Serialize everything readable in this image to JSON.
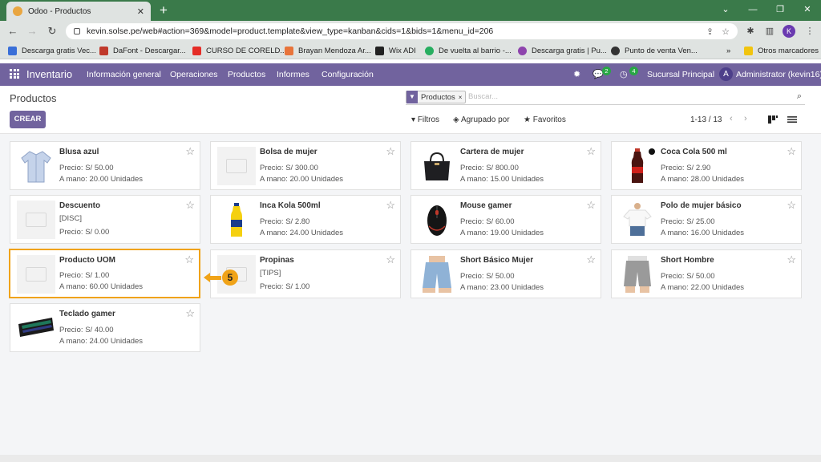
{
  "browser": {
    "tab_title": "Odoo - Productos",
    "tab_close": "✕",
    "new_tab": "+",
    "url": "kevin.solse.pe/web#action=369&model=product.template&view_type=kanban&cids=1&bids=1&menu_id=206",
    "profile_initial": "K",
    "bookmarks": [
      {
        "label": "Descarga gratis Vec...",
        "color": "#3a6fd8"
      },
      {
        "label": "DaFont - Descargar...",
        "color": "#c0392b"
      },
      {
        "label": "CURSO DE CORELD...",
        "color": "#e52d27"
      },
      {
        "label": "Brayan Mendoza Ar...",
        "color": "#e8743b"
      },
      {
        "label": "Wix ADI",
        "color": "#222222"
      },
      {
        "label": "De vuelta al barrio -...",
        "color": "#27ae60"
      },
      {
        "label": "Descarga gratis | Pu...",
        "color": "#8e44ad"
      },
      {
        "label": "Punto de venta Ven...",
        "color": "#333333"
      }
    ],
    "bookmarks_more": "»",
    "other_bookmarks": "Otros marcadores"
  },
  "navbar": {
    "app_name": "Inventario",
    "menu": [
      "Información general",
      "Operaciones",
      "Productos",
      "Informes",
      "Configuración"
    ],
    "messages_count": "2",
    "activities_count": "4",
    "company": "Sucursal Principal",
    "user_initial": "A",
    "user_name": "Administrator (kevin16)"
  },
  "control_panel": {
    "title": "Productos",
    "create_label": "CREAR",
    "facet_label": "Productos",
    "facet_remove": "×",
    "search_placeholder": "Buscar...",
    "filters_label": "Filtros",
    "group_by_label": "Agrupado por",
    "favorites_label": "Favoritos",
    "pager": "1-13 / 13"
  },
  "products": [
    {
      "name": "Blusa azul",
      "ref": "",
      "price": "Precio: S/ 50.00",
      "qty": "A mano: 20.00 Unidades",
      "image": "blouse"
    },
    {
      "name": "Bolsa de mujer",
      "ref": "",
      "price": "Precio: S/ 300.00",
      "qty": "A mano: 20.00 Unidades",
      "image": "placeholder"
    },
    {
      "name": "Cartera de mujer",
      "ref": "",
      "price": "Precio: S/ 800.00",
      "qty": "A mano: 15.00 Unidades",
      "image": "handbag"
    },
    {
      "name": "Coca Cola 500 ml",
      "ref": "",
      "price": "Precio: S/ 2.90",
      "qty": "A mano: 28.00 Unidades",
      "image": "cola"
    },
    {
      "name": "Descuento",
      "ref": "[DISC]",
      "price": "Precio: S/ 0.00",
      "qty": "",
      "image": "placeholder"
    },
    {
      "name": "Inca Kola 500ml",
      "ref": "",
      "price": "Precio: S/ 2.80",
      "qty": "A mano: 24.00 Unidades",
      "image": "inca"
    },
    {
      "name": "Mouse gamer",
      "ref": "",
      "price": "Precio: S/ 60.00",
      "qty": "A mano: 19.00 Unidades",
      "image": "mouse"
    },
    {
      "name": "Polo de mujer básico",
      "ref": "",
      "price": "Precio: S/ 25.00",
      "qty": "A mano: 16.00 Unidades",
      "image": "tshirt"
    },
    {
      "name": "Producto UOM",
      "ref": "",
      "price": "Precio: S/ 1.00",
      "qty": "A mano: 60.00 Unidades",
      "image": "placeholder"
    },
    {
      "name": "Propinas",
      "ref": "[TIPS]",
      "price": "Precio: S/ 1.00",
      "qty": "",
      "image": "placeholder"
    },
    {
      "name": "Short Básico Mujer",
      "ref": "",
      "price": "Precio: S/ 50.00",
      "qty": "A mano: 23.00 Unidades",
      "image": "shorts_denim"
    },
    {
      "name": "Short Hombre",
      "ref": "",
      "price": "Precio: S/ 50.00",
      "qty": "A mano: 22.00 Unidades",
      "image": "shorts_grey"
    },
    {
      "name": "Teclado gamer",
      "ref": "",
      "price": "Precio: S/ 40.00",
      "qty": "A mano: 24.00 Unidades",
      "image": "keyboard"
    }
  ],
  "callout": {
    "number": "5"
  },
  "colors": {
    "odoo_purple": "#71639e",
    "highlight": "#f0a318"
  }
}
